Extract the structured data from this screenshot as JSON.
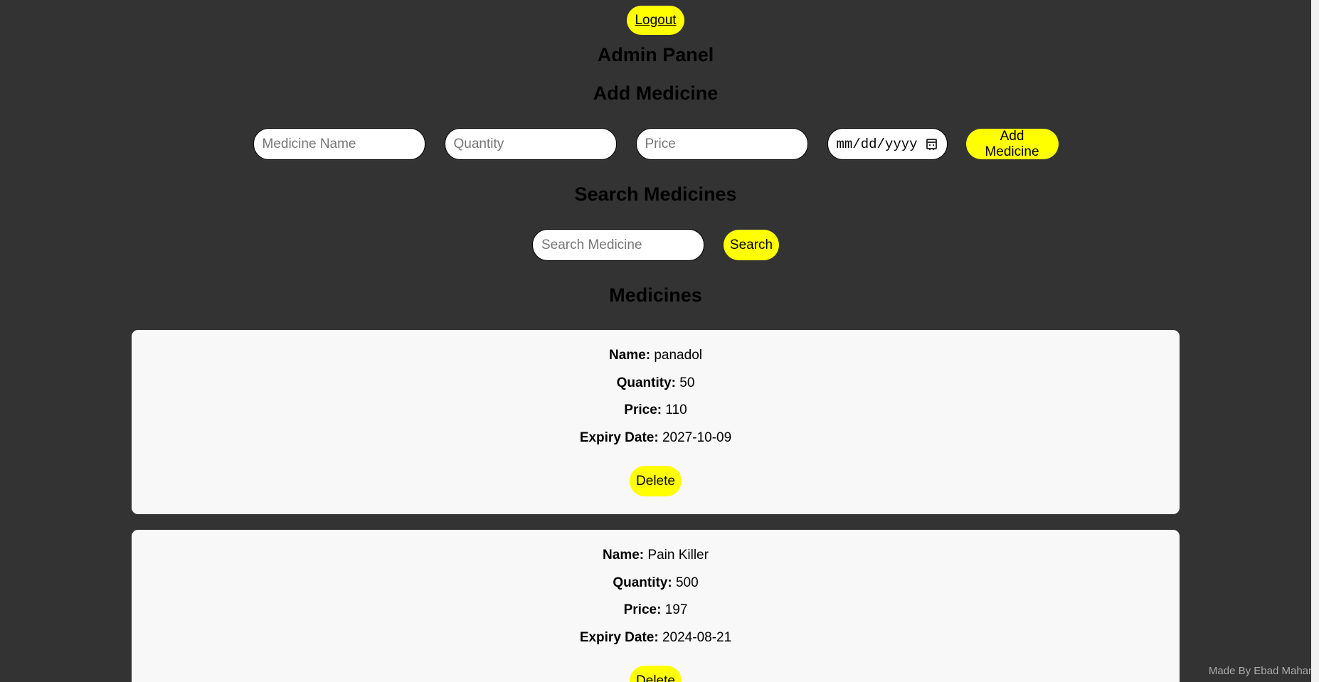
{
  "header": {
    "logout_label": "Logout",
    "title": "Admin Panel"
  },
  "add_section": {
    "title": "Add Medicine",
    "name_placeholder": "Medicine Name",
    "quantity_placeholder": "Quantity",
    "price_placeholder": "Price",
    "date_placeholder": "mm/dd/yyyy",
    "add_label": "Add Medicine"
  },
  "search_section": {
    "title": "Search Medicines",
    "search_placeholder": "Search Medicine",
    "search_label": "Search"
  },
  "list_section": {
    "title": "Medicines",
    "labels": {
      "name": "Name:",
      "quantity": "Quantity:",
      "price": "Price:",
      "expiry": "Expiry Date:"
    },
    "delete_label": "Delete",
    "items": [
      {
        "name": "panadol",
        "quantity": "50",
        "price": "110",
        "expiry": "2027-10-09"
      },
      {
        "name": "Pain Killer",
        "quantity": "500",
        "price": "197",
        "expiry": "2024-08-21"
      }
    ]
  },
  "footer": {
    "credit": "Made By Ebad Mahar"
  },
  "colors": {
    "background": "#333333",
    "accent": "#ffff00",
    "card": "#f8f8f8"
  }
}
